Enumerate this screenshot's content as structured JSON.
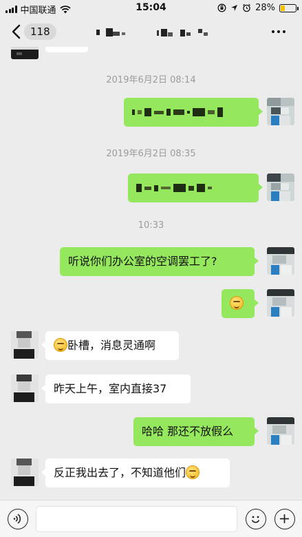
{
  "status_bar": {
    "carrier": "中国联通",
    "time": "15:04",
    "battery_percent": "28%",
    "battery_level": 0.28,
    "battery_color": "#f2c100"
  },
  "nav": {
    "back_count": "118",
    "back_icon": "chevron-left-icon",
    "more_icon": "more-icon"
  },
  "messages": [
    {
      "type": "timestamp",
      "text": "2019年6月2日 08:14"
    },
    {
      "type": "outgoing",
      "text": ""
    },
    {
      "type": "timestamp",
      "text": "2019年6月2日 08:35"
    },
    {
      "type": "outgoing",
      "text": ""
    },
    {
      "type": "timestamp",
      "text": "10:33"
    },
    {
      "type": "outgoing",
      "text": "听说你们办公室的空调罢工了?"
    },
    {
      "type": "outgoing",
      "text": "",
      "emoji": "blush-emoji"
    },
    {
      "type": "incoming",
      "text": "卧槽，消息灵通啊",
      "emoji": "blush-emoji"
    },
    {
      "type": "incoming",
      "text": "昨天上午，室内直接37"
    },
    {
      "type": "outgoing",
      "text": "哈哈 那还不放假么"
    },
    {
      "type": "incoming",
      "text": "反正我出去了，不知道他们",
      "emoji": "thinking-emoji"
    }
  ],
  "input_bar": {
    "voice_icon": "voice-icon",
    "emoji_icon": "emoji-icon",
    "add_icon": "plus-icon"
  },
  "colors": {
    "outgoing_bubble": "#95e75e",
    "incoming_bubble": "#ffffff",
    "background": "#ececec",
    "timestamp": "#9b9b9b"
  }
}
